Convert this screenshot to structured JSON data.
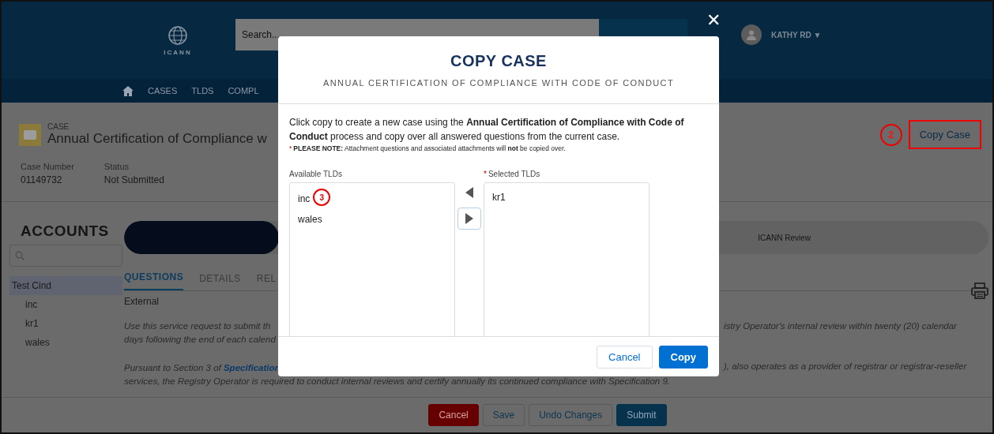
{
  "header": {
    "logo_text": "ICANN",
    "search": {
      "placeholder": "Search..."
    },
    "user": {
      "name": "KATHY RD",
      "caret": "▼"
    }
  },
  "nav": {
    "items": [
      "CASES",
      "TLDS",
      "COMPL"
    ]
  },
  "case": {
    "eyebrow": "CASE",
    "title": "Annual Certification of Compliance w",
    "copy_button": "Copy Case",
    "callout": "2",
    "fields": [
      {
        "label": "Case Number",
        "value": "01149732"
      },
      {
        "label": "Status",
        "value": "Not Submitted"
      }
    ]
  },
  "sidebar": {
    "title": "ACCOUNTS",
    "items": [
      {
        "label": "Test Cind",
        "selected": true,
        "children": [
          {
            "label": "inc",
            "selected": false
          },
          {
            "label": "kr1",
            "selected": false
          },
          {
            "label": "wales",
            "selected": false
          }
        ]
      }
    ]
  },
  "path": {
    "stages": [
      {
        "label": "ICANN Review",
        "selected": false
      }
    ]
  },
  "tabs": [
    {
      "label": "QUESTIONS",
      "selected": true
    },
    {
      "label": "DETAILS",
      "selected": false
    },
    {
      "label": "REL",
      "selected": false
    }
  ],
  "section_label": "External",
  "paragraphs": [
    {
      "left": [
        "Use this service request to submit th",
        "days following the end of each calend"
      ],
      "right": "istry Operator's internal review within twenty (20) calendar"
    },
    {
      "left_prefix": "Pursuant to Section 3 of ",
      "left_link": "Specification",
      "right": "), also operates as a provider of registrar or registrar-reseller",
      "tail": "services, the Registry Operator is required to conduct internal reviews and certify annually its continued compliance with Specification 9."
    }
  ],
  "footer_buttons": [
    {
      "label": "Cancel",
      "kind": "danger"
    },
    {
      "label": "Save",
      "kind": "neutral"
    },
    {
      "label": "Undo Changes",
      "kind": "neutral"
    },
    {
      "label": "Submit",
      "kind": "brand"
    }
  ],
  "modal": {
    "close": "✕",
    "title": "COPY CASE",
    "subtitle": "ANNUAL CERTIFICATION OF COMPLIANCE WITH CODE OF CONDUCT",
    "intro": "Click copy to create a new case using the **Annual Certification of Compliance with Code of Conduct** process and copy over all answered questions from the current case.",
    "note_mark": "*",
    "note": "**PLEASE NOTE:** Attachment questions and associated attachments will **not** be copied over.",
    "available": {
      "label": "Available TLDs",
      "items": [
        "inc",
        "wales"
      ],
      "callout": "3"
    },
    "selected": {
      "label": "Selected TLDs",
      "required_mark": "*",
      "items": [
        "kr1"
      ]
    },
    "buttons": [
      {
        "label": "Cancel",
        "kind": "neutral"
      },
      {
        "label": "Copy",
        "kind": "brand"
      }
    ]
  }
}
